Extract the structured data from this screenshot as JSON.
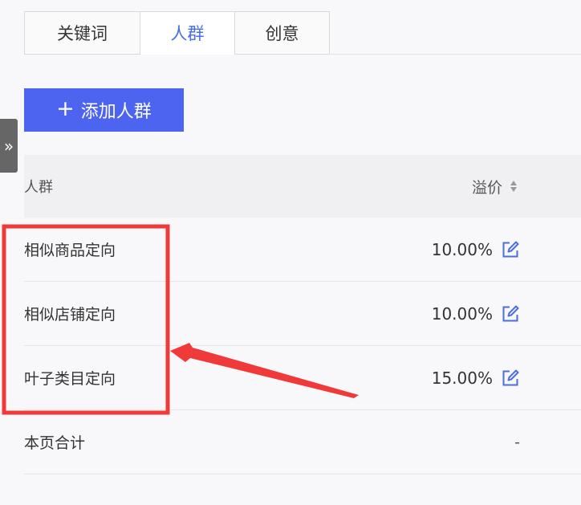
{
  "tabs": [
    {
      "label": "关键词",
      "active": false
    },
    {
      "label": "人群",
      "active": true
    },
    {
      "label": "创意",
      "active": false
    }
  ],
  "add_button": {
    "icon": "plus-icon",
    "label": "添加人群"
  },
  "side_toggle": {
    "icon": "double-chevron-right-icon",
    "glyph": "»"
  },
  "table": {
    "headers": {
      "name": "人群",
      "price": "溢价"
    },
    "rows": [
      {
        "name": "相似商品定向",
        "price": "10.00%"
      },
      {
        "name": "相似店铺定向",
        "price": "10.00%"
      },
      {
        "name": "叶子类目定向",
        "price": "15.00%"
      }
    ],
    "total": {
      "label": "本页合计",
      "value": "-"
    }
  },
  "colors": {
    "accent": "#4d64f0",
    "tab_active": "#4a6ee0",
    "annotation": "#f03a3a"
  }
}
